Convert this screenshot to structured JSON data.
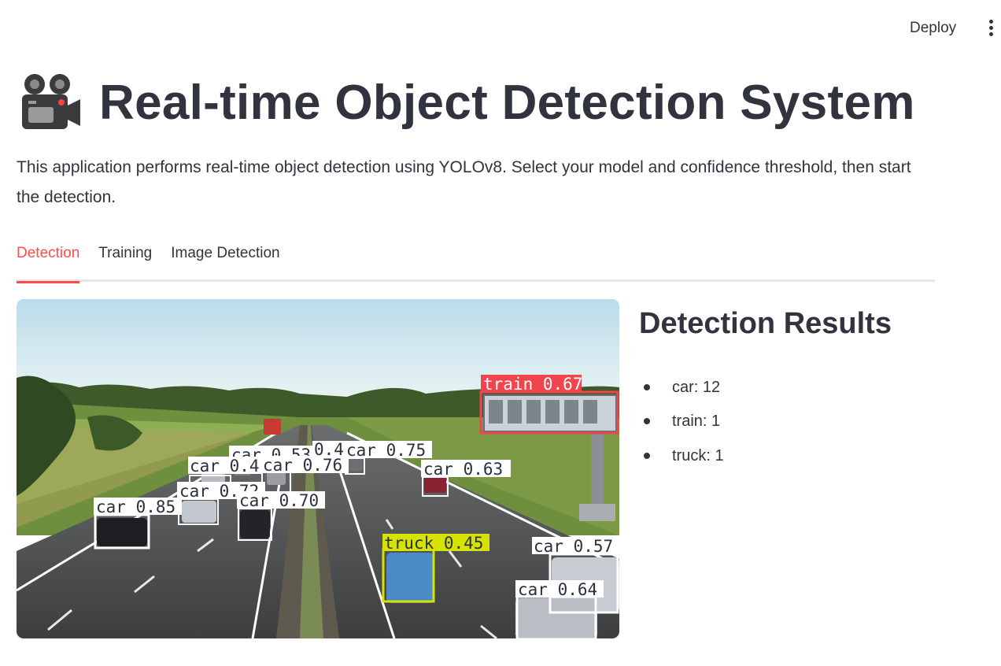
{
  "header": {
    "deploy_label": "Deploy",
    "menu_icon": "more-vertical-icon"
  },
  "page": {
    "title_icon": "movie-camera-icon",
    "title": "Real-time Object Detection System",
    "description": "This application performs real-time object detection using YOLOv8. Select your model and confidence threshold, then start the detection."
  },
  "tabs": [
    {
      "label": "Detection",
      "active": true
    },
    {
      "label": "Training",
      "active": false
    },
    {
      "label": "Image Detection",
      "active": false
    }
  ],
  "colors": {
    "accent": "#ff4b4b",
    "text": "#31333f",
    "car_box": "#ffffff",
    "train_box": "#f0454f",
    "truck_box": "#d6e300"
  },
  "video": {
    "detections": [
      {
        "cls": "train",
        "label": "train 0.67"
      },
      {
        "cls": "car",
        "label": "car 0.75"
      },
      {
        "cls": "car",
        "label": "car 0.63"
      },
      {
        "cls": "car",
        "label": "car 0.53"
      },
      {
        "cls": "car",
        "label": "0.4"
      },
      {
        "cls": "car",
        "label": "car 0.4"
      },
      {
        "cls": "car",
        "label": "car 0.76"
      },
      {
        "cls": "car",
        "label": "car 0.72"
      },
      {
        "cls": "car",
        "label": "car 0.70"
      },
      {
        "cls": "car",
        "label": "car 0.85"
      },
      {
        "cls": "truck",
        "label": "truck 0.45"
      },
      {
        "cls": "car",
        "label": "car 0.57"
      },
      {
        "cls": "car",
        "label": "car 0.64"
      }
    ]
  },
  "results": {
    "title": "Detection Results",
    "items": [
      {
        "label": "car: 12"
      },
      {
        "label": "train: 1"
      },
      {
        "label": "truck: 1"
      }
    ]
  }
}
